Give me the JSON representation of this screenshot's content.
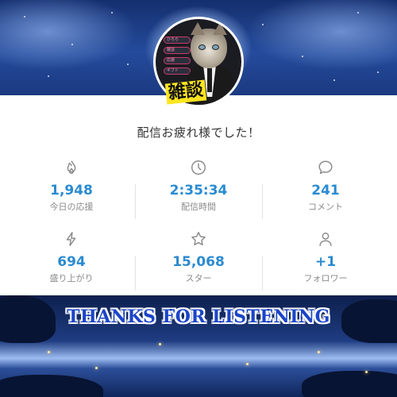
{
  "header": {
    "title": "配信お疲れ様でした！"
  },
  "avatar": {
    "badge": "雑談",
    "menu_items": [
      "ひろら",
      "雑談",
      "応援",
      "ギフト"
    ]
  },
  "stats": [
    {
      "icon": "flame-icon",
      "value": "1,948",
      "label": "今日の応援"
    },
    {
      "icon": "clock-icon",
      "value": "2:35:34",
      "label": "配信時間"
    },
    {
      "icon": "comment-icon",
      "value": "241",
      "label": "コメント"
    },
    {
      "icon": "lightning-icon",
      "value": "694",
      "label": "盛り上がり"
    },
    {
      "icon": "star-icon",
      "value": "15,068",
      "label": "スター"
    },
    {
      "icon": "person-icon",
      "value": "+1",
      "label": "フォロワー"
    }
  ],
  "banner": {
    "text": "THANKS FOR LISTENING"
  },
  "colors": {
    "accent": "#2a8bd0",
    "label": "#8b8b8b",
    "banner": "#1b45c8"
  }
}
